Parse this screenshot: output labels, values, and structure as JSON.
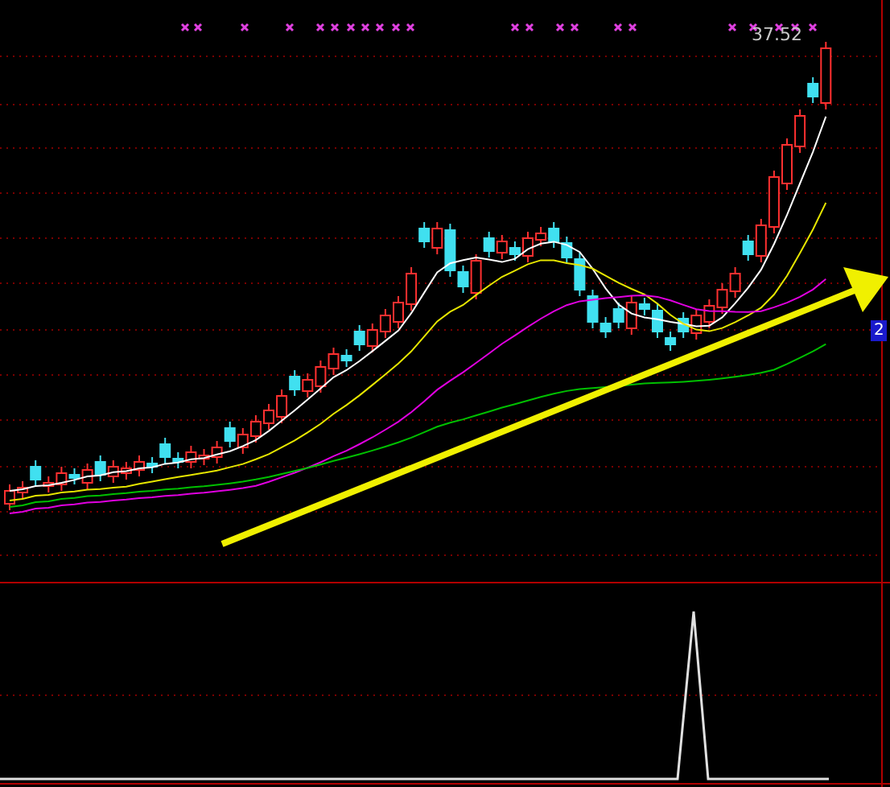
{
  "main_chart": {
    "last_price": "37.52"
  },
  "right_axis": {
    "label": "2"
  }
}
